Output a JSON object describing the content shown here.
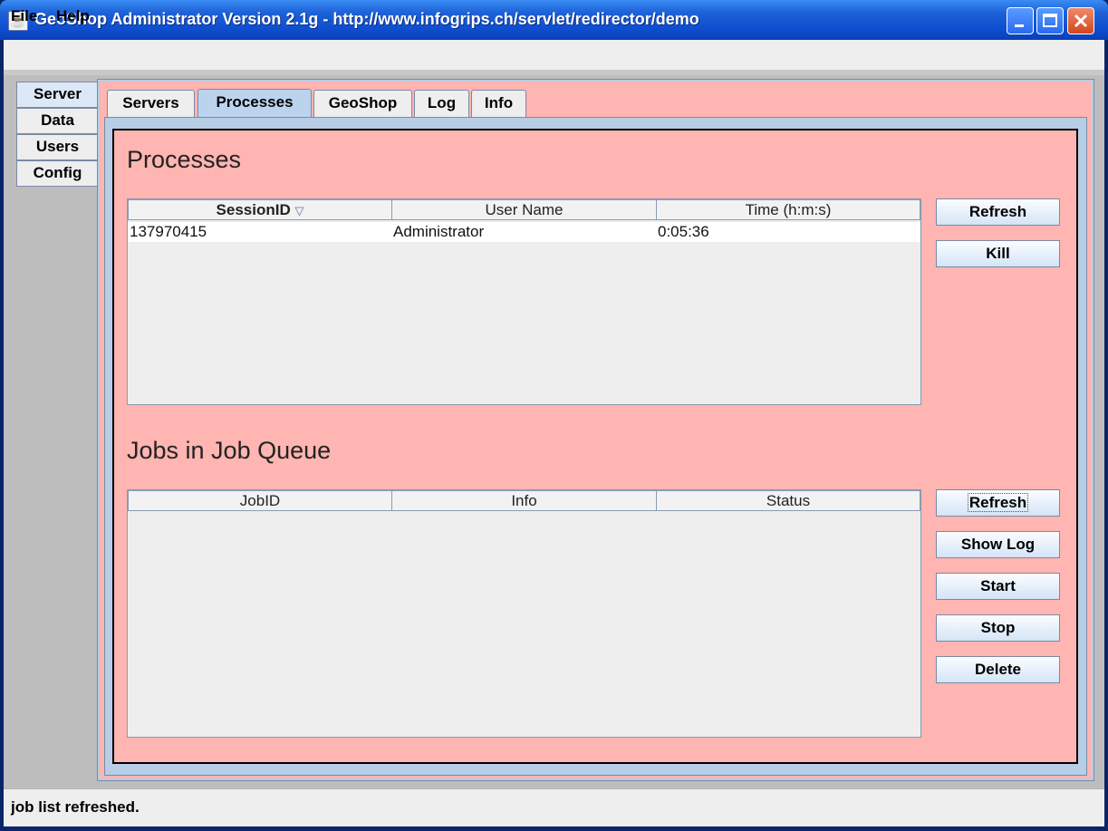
{
  "window": {
    "title": "GeoShop Administrator Version 2.1g - http://www.infogrips.ch/servlet/redirector/demo",
    "minimize_icon": "minimize-icon",
    "maximize_icon": "maximize-icon",
    "close_icon": "close-icon"
  },
  "menubar": {
    "items": [
      "File",
      "Help"
    ]
  },
  "side_tabs": [
    "Server",
    "Data",
    "Users",
    "Config"
  ],
  "top_tabs": [
    "Servers",
    "Processes",
    "GeoShop",
    "Log",
    "Info"
  ],
  "processes": {
    "heading": "Processes",
    "columns": [
      "SessionID",
      "User Name",
      "Time (h:m:s)"
    ],
    "sort_icon": "sort-descending-icon",
    "rows": [
      {
        "session_id": "137970415",
        "user": "Administrator",
        "time": "0:05:36"
      }
    ],
    "buttons": [
      "Refresh",
      "Kill"
    ]
  },
  "jobs": {
    "heading": "Jobs in Job Queue",
    "columns": [
      "JobID",
      "Info",
      "Status"
    ],
    "buttons": [
      "Refresh",
      "Show Log",
      "Start",
      "Stop",
      "Delete"
    ]
  },
  "status": "job list refreshed.",
  "colors": {
    "panel_bg": "#ffb5b1",
    "title_blue": "#0f4fd0"
  }
}
